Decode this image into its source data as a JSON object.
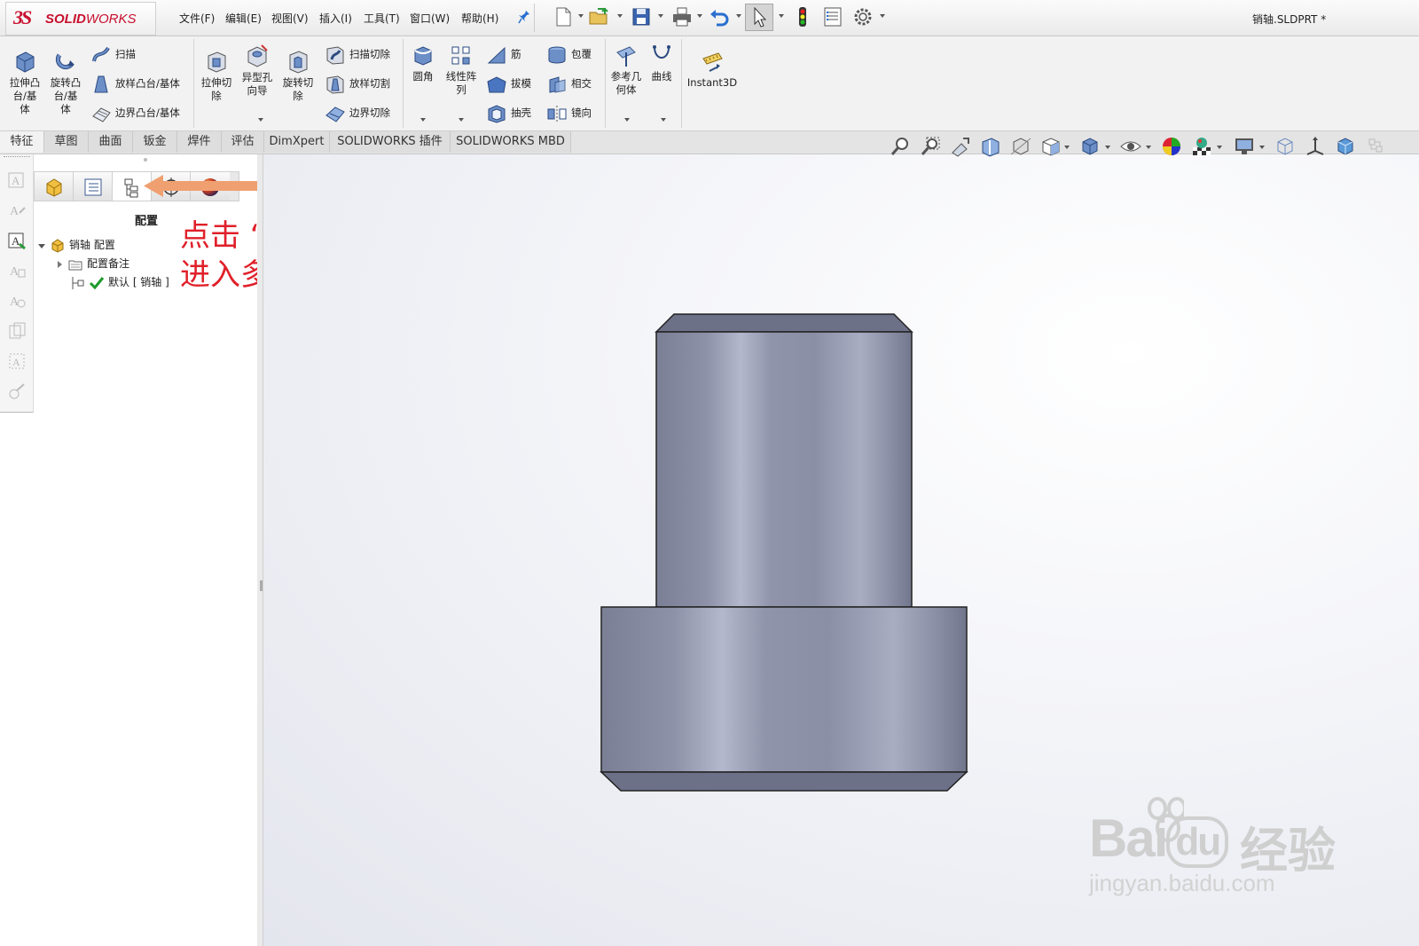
{
  "window": {
    "title": "销轴.SLDPRT *"
  },
  "logo": {
    "ds": "3S",
    "brand_a": "SOLID",
    "brand_b": "WORKS"
  },
  "menu": [
    "文件(F)",
    "编辑(E)",
    "视图(V)",
    "插入(I)",
    "工具(T)",
    "窗口(W)",
    "帮助(H)"
  ],
  "ribbon": {
    "extrude_boss": [
      "拉伸凸",
      "台/基",
      "体"
    ],
    "revolve_boss": [
      "旋转凸",
      "台/基",
      "体"
    ],
    "sweep": "扫描",
    "loft": "放样凸台/基体",
    "boundary": "边界凸台/基体",
    "extrude_cut": [
      "拉伸切",
      "除"
    ],
    "hole_wizard": [
      "异型孔",
      "向导"
    ],
    "revolve_cut": [
      "旋转切",
      "除"
    ],
    "swept_cut": "扫描切除",
    "lofted_cut": "放样切割",
    "boundary_cut": "边界切除",
    "fillet": "圆角",
    "linear_pattern": [
      "线性阵",
      "列"
    ],
    "rib": "筋",
    "draft": "拔模",
    "shell": "抽壳",
    "wrap": "包覆",
    "intersect": "相交",
    "mirror": "镜向",
    "ref_geometry": [
      "参考几",
      "何体"
    ],
    "curves": "曲线",
    "instant3d": "Instant3D"
  },
  "tabs": [
    "特征",
    "草图",
    "曲面",
    "钣金",
    "焊件",
    "评估",
    "DimXpert",
    "SOLIDWORKS 插件",
    "SOLIDWORKS MBD"
  ],
  "panel": {
    "title": "配置",
    "tree": {
      "root": "销轴 配置",
      "notes": "配置备注",
      "default": "默认 [ 销轴 ]"
    }
  },
  "annotation": {
    "line1": "点击 “配置” 选项卡",
    "line2": "进入多配置界面",
    "color": "#e0202a"
  },
  "watermark": {
    "brand_latin": "Bai",
    "brand_du": "du",
    "brand_cn": "经验",
    "url": "jingyan.baidu.com"
  },
  "colors": {
    "accent": "#c8102e",
    "arrow": "#f0a070",
    "part": "#8e92a8"
  }
}
